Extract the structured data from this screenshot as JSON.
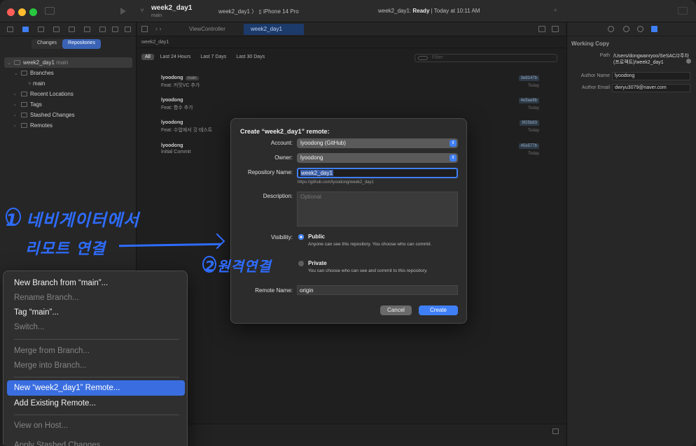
{
  "titlebar": {
    "project": "week2_day1",
    "branch": "main",
    "scheme": "week2_day1 〉 ▯ iPhone 14 Pro",
    "status_prefix": "week2_day1: ",
    "status_bold": "Ready",
    "status_suffix": " | Today at 10:11 AM"
  },
  "navigator": {
    "segments": {
      "changes": "Changes",
      "repositories": "Repositories"
    },
    "tree": {
      "repo": "week2_day1",
      "repo_branch": "main",
      "branches": "Branches",
      "main": "main",
      "recent": "Recent Locations",
      "tags": "Tags",
      "stashed": "Stashed Changes",
      "remotes": "Remotes"
    }
  },
  "editor": {
    "tabs": {
      "t1": "ViewController",
      "t2": "week2_day1"
    },
    "jumpbar": "week2_day1",
    "filters": [
      "All",
      "Last 24 Hours",
      "Last 7 Days",
      "Last 30 Days"
    ],
    "filter_placeholder": "Filter",
    "commits": [
      {
        "author": "lyoodong",
        "badge": "main",
        "message": "Feat: 커밋VC 추가",
        "hash": "3e8147b",
        "time": "Today"
      },
      {
        "author": "lyoodong",
        "badge": "",
        "message": "Feat: 함수 추가",
        "hash": "4e5ae8b",
        "time": "Today"
      },
      {
        "author": "lyoodong",
        "badge": "",
        "message": "Feat: 수업에서 깃 테스트",
        "hash": "9f25b83",
        "time": "Today"
      },
      {
        "author": "lyoodong",
        "badge": "",
        "message": "Initial Commit",
        "hash": "45e577b",
        "time": "Today"
      }
    ]
  },
  "inspector": {
    "heading": "Working Copy",
    "path_label": "Path",
    "path_value": "/Users/dongwanryoo/SeSAC/2주차(프로젝트)/week2_day1",
    "author_name_label": "Author Name",
    "author_name_value": "lyoodong",
    "author_email_label": "Author Email",
    "author_email_value": "dwryu3079@naver.com"
  },
  "dialog": {
    "title": "Create “week2_day1” remote:",
    "account_label": "Account:",
    "account_value": "lyoodong (GitHub)",
    "owner_label": "Owner:",
    "owner_value": "lyoodong",
    "repo_name_label": "Repository Name:",
    "repo_name_value": "week2_day1",
    "repo_url": "https://github.com/lyoodong/week2_day1",
    "description_label": "Description:",
    "description_placeholder": "Optional",
    "visibility_label": "Visibility:",
    "public_title": "Public",
    "public_desc": "Anyone can see this repository. You choose who can commit.",
    "private_title": "Private",
    "private_desc": "You can choose who can see and commit to this repository.",
    "remote_name_label": "Remote Name:",
    "remote_name_value": "origin",
    "cancel": "Cancel",
    "create": "Create"
  },
  "context_menu": {
    "new_branch": "New Branch from “main”...",
    "rename_branch": "Rename Branch...",
    "tag": "Tag “main”...",
    "switch": "Switch...",
    "merge_from": "Merge from Branch...",
    "merge_into": "Merge into Branch...",
    "new_remote": "New “week2_day1” Remote...",
    "add_remote": "Add Existing Remote...",
    "view_on_host": "View on Host...",
    "apply_stashed": "Apply Stashed Changes..."
  },
  "annotations": {
    "line1_num": "1",
    "line1": "네비게이터에서",
    "line2": "리모트 연결",
    "line3_num": "2",
    "line3": "원격연결"
  },
  "colors": {
    "accent": "#3f7ff5",
    "annotation": "#2e6cff",
    "menu_highlight": "#3a6ee0"
  }
}
